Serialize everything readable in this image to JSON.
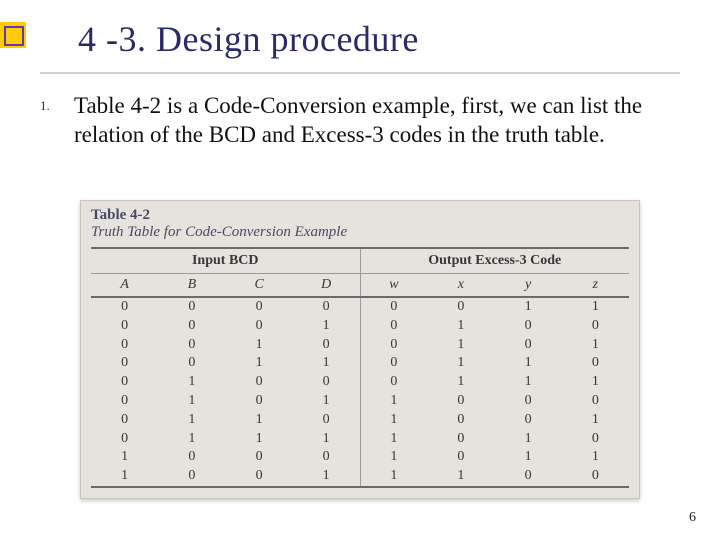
{
  "title": "4 -3. Design procedure",
  "list_number": "1.",
  "body_text": "Table 4-2 is a Code-Conversion example, first, we can list the relation of the BCD and Excess-3 codes in the truth table.",
  "figure": {
    "label": "Table 4-2",
    "subtitle": "Truth Table for Code-Conversion Example",
    "input_header": "Input BCD",
    "output_header": "Output Excess-3 Code",
    "input_vars": [
      "A",
      "B",
      "C",
      "D"
    ],
    "output_vars": [
      "w",
      "x",
      "y",
      "z"
    ]
  },
  "chart_data": {
    "type": "table",
    "title": "Truth Table for Code-Conversion Example",
    "input_columns": [
      "A",
      "B",
      "C",
      "D"
    ],
    "output_columns": [
      "w",
      "x",
      "y",
      "z"
    ],
    "rows": [
      {
        "A": 0,
        "B": 0,
        "C": 0,
        "D": 0,
        "w": 0,
        "x": 0,
        "y": 1,
        "z": 1
      },
      {
        "A": 0,
        "B": 0,
        "C": 0,
        "D": 1,
        "w": 0,
        "x": 1,
        "y": 0,
        "z": 0
      },
      {
        "A": 0,
        "B": 0,
        "C": 1,
        "D": 0,
        "w": 0,
        "x": 1,
        "y": 0,
        "z": 1
      },
      {
        "A": 0,
        "B": 0,
        "C": 1,
        "D": 1,
        "w": 0,
        "x": 1,
        "y": 1,
        "z": 0
      },
      {
        "A": 0,
        "B": 1,
        "C": 0,
        "D": 0,
        "w": 0,
        "x": 1,
        "y": 1,
        "z": 1
      },
      {
        "A": 0,
        "B": 1,
        "C": 0,
        "D": 1,
        "w": 1,
        "x": 0,
        "y": 0,
        "z": 0
      },
      {
        "A": 0,
        "B": 1,
        "C": 1,
        "D": 0,
        "w": 1,
        "x": 0,
        "y": 0,
        "z": 1
      },
      {
        "A": 0,
        "B": 1,
        "C": 1,
        "D": 1,
        "w": 1,
        "x": 0,
        "y": 1,
        "z": 0
      },
      {
        "A": 1,
        "B": 0,
        "C": 0,
        "D": 0,
        "w": 1,
        "x": 0,
        "y": 1,
        "z": 1
      },
      {
        "A": 1,
        "B": 0,
        "C": 0,
        "D": 1,
        "w": 1,
        "x": 1,
        "y": 0,
        "z": 0
      }
    ]
  },
  "page_number": "6"
}
